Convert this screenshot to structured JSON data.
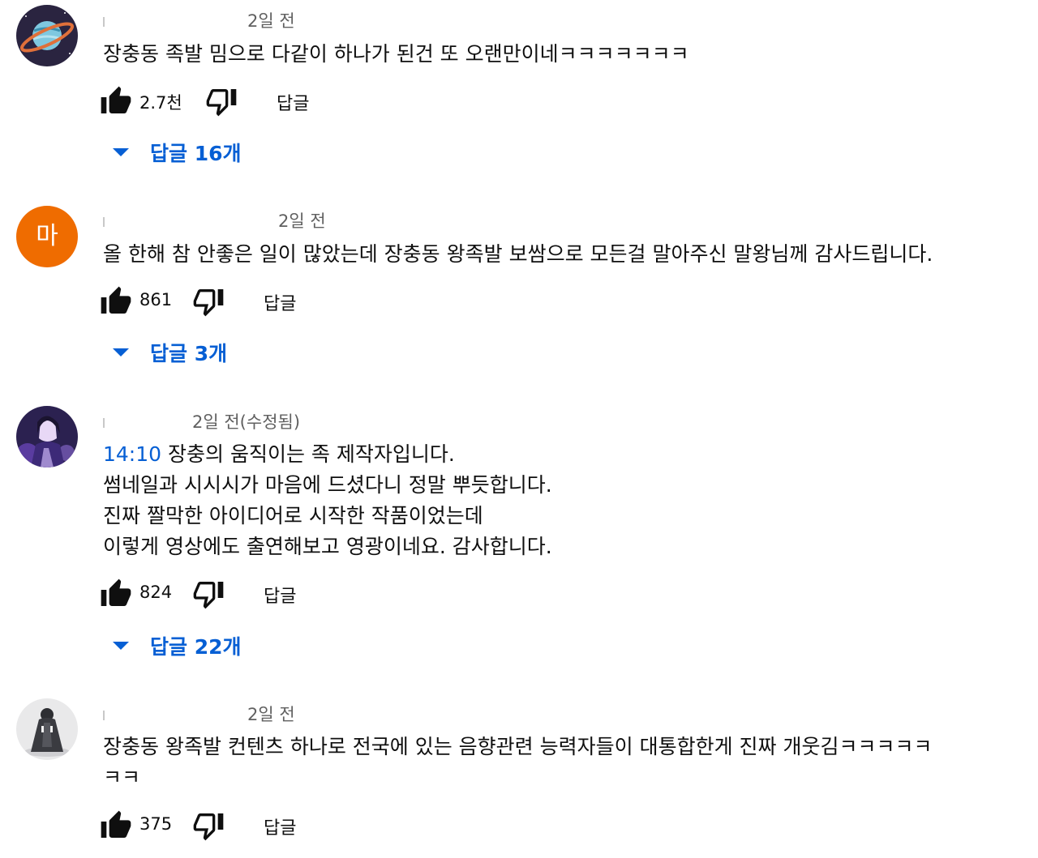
{
  "comments": [
    {
      "avatar": {
        "icon": "saturn-planet-avatar"
      },
      "timestamp": "2일 전",
      "lines": [
        "장충동 족발 밈으로 다같이 하나가 된건 또 오랜만이네ㅋㅋㅋㅋㅋㅋㅋ"
      ],
      "like_count": "2.7천",
      "reply_label": "답글",
      "replies_toggle": "답글 16개"
    },
    {
      "avatar": {
        "icon": "initial-avatar",
        "initial": "마",
        "color": "#ef6c00"
      },
      "timestamp": "2일 전",
      "lines": [
        "올 한해 참 안좋은 일이 많았는데 장충동 왕족발 보쌈으로 모든걸 말아주신 말왕님께 감사드립니다."
      ],
      "like_count": "861",
      "reply_label": "답글",
      "replies_toggle": "답글 3개"
    },
    {
      "avatar": {
        "icon": "purple-character-avatar"
      },
      "timestamp": "2일 전(수정됨)",
      "timestamp_link": "14:10",
      "first_line_rest": " 장충의 움직이는 족 제작자입니다.",
      "lines": [
        "썸네일과 시시시가 마음에 드셨다니 정말 뿌듯합니다.",
        "진짜 짤막한 아이디어로 시작한 작품이었는데",
        "이렇게 영상에도 출연해보고 영광이네요. 감사합니다."
      ],
      "like_count": "824",
      "reply_label": "답글",
      "replies_toggle": "답글 22개"
    },
    {
      "avatar": {
        "icon": "cloaked-figure-avatar"
      },
      "timestamp": "2일 전",
      "lines": [
        "장충동 왕족발 컨텐츠 하나로 전국에 있는 음향관련 능력자들이 대통합한게 진짜 개웃김ㅋㅋㅋㅋㅋ",
        "ㅋㅋ"
      ],
      "like_count": "375",
      "reply_label": "답글"
    }
  ],
  "colors": {
    "link": "#065fd4",
    "text": "#0f0f0f",
    "meta": "#606060"
  }
}
